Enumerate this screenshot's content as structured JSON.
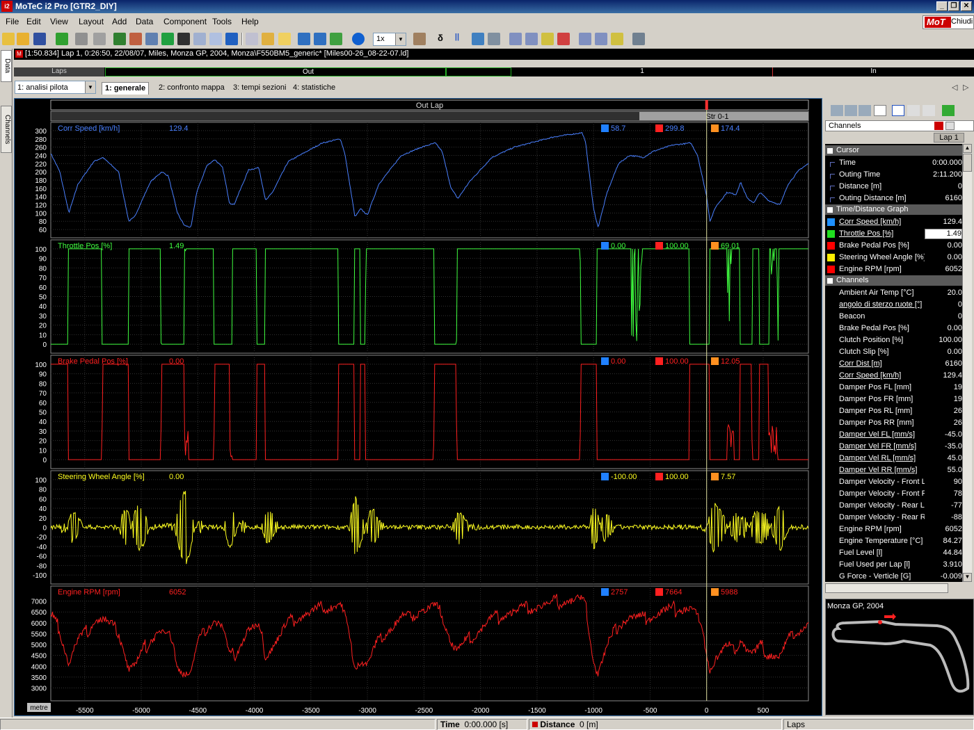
{
  "window": {
    "app_icon": "i2",
    "title": "MoTeC i2 Pro [GTR2_DIY]",
    "min": "_",
    "restore": "❐",
    "close": "✕"
  },
  "menu": [
    "File",
    "Edit",
    "View",
    "Layout",
    "Add",
    "Data",
    "Component",
    "Tools",
    "Help"
  ],
  "logo": {
    "brand": "MoT",
    "close_label": "Chiudi"
  },
  "toolbar": {
    "zoom_value": "1x",
    "delta_symbol": "δ",
    "pause_symbol": "||"
  },
  "left_tabs": {
    "data": "Data",
    "channels": "Channels"
  },
  "info": {
    "icon": "M",
    "text": "[1:50.834] Lap 1, 0:26:50, 22/08/07, Miles, Monza GP, 2004, Monza\\F550BM5_generic* [Miles00-26_08-22-07.ld]"
  },
  "laps_bar": {
    "label": "Laps",
    "out": "Out",
    "lap1": "1",
    "in": "In"
  },
  "worksheet": {
    "selected": "1: analisi pilota",
    "tabs": [
      "1: generale",
      "2: confronto mappa",
      "3: tempi sezioni",
      "4: statistiche"
    ],
    "nav_left": "◁",
    "nav_right": "▷"
  },
  "graph": {
    "lap_label": "Out Lap",
    "sector_label": "Str 0-1",
    "x_unit": "metre",
    "x_ticks": [
      "-5500",
      "-5000",
      "-4500",
      "-4000",
      "-3500",
      "-3000",
      "-2500",
      "-2000",
      "-1500",
      "-1000",
      "-500",
      "0",
      "500"
    ],
    "x_values": [
      -5500,
      -5000,
      -4500,
      -4000,
      -3500,
      -3000,
      -2500,
      -2000,
      -1500,
      -1000,
      -500,
      0,
      500
    ],
    "x_range": [
      -5800,
      900
    ],
    "cursor_x": 0,
    "panes": [
      {
        "name": "Corr Speed [km/h]",
        "value": "129.4",
        "min": "58.7",
        "max": "299.8",
        "avg": "174.4",
        "color": "#4a80ff",
        "ticks": [
          "300",
          "280",
          "260",
          "240",
          "220",
          "200",
          "180",
          "160",
          "140",
          "120",
          "100",
          "80",
          "60"
        ],
        "range": [
          50,
          310
        ],
        "style": "smooth"
      },
      {
        "name": "Throttle Pos [%]",
        "value": "1.49",
        "min": "0.00",
        "max": "100.00",
        "avg": "69.01",
        "color": "#40ff40",
        "ticks": [
          "100",
          "90",
          "80",
          "70",
          "60",
          "50",
          "40",
          "30",
          "20",
          "10",
          "0"
        ],
        "range": [
          -5,
          105
        ],
        "style": "throttle"
      },
      {
        "name": "Brake Pedal Pos [%]",
        "value": "0.00",
        "min": "0.00",
        "max": "100.00",
        "avg": "12.05",
        "color": "#ff2020",
        "ticks": [
          "100",
          "90",
          "80",
          "70",
          "60",
          "50",
          "40",
          "30",
          "20",
          "10",
          "0"
        ],
        "range": [
          -5,
          105
        ],
        "style": "brake"
      },
      {
        "name": "Steering Wheel Angle [%]",
        "value": "0.00",
        "min": "-100.00",
        "max": "100.00",
        "avg": "7.57",
        "color": "#ffff20",
        "ticks": [
          "100",
          "80",
          "60",
          "40",
          "20",
          "0",
          "-20",
          "-40",
          "-60",
          "-80",
          "-100"
        ],
        "range": [
          -110,
          110
        ],
        "style": "steer"
      },
      {
        "name": "Engine RPM [rpm]",
        "value": "6052",
        "min": "2757",
        "max": "7664",
        "avg": "5988",
        "color": "#ff2020",
        "ticks": [
          "7000",
          "6500",
          "6000",
          "5500",
          "5000",
          "4500",
          "4000",
          "3500",
          "3000"
        ],
        "range": [
          2600,
          7500
        ],
        "style": "rpm"
      }
    ]
  },
  "right_panel": {
    "header": "Channels",
    "lap_tab": "Lap 1",
    "groups": [
      {
        "title": "Cursor",
        "rows": [
          {
            "name": "Time",
            "value": "0:00.000",
            "color": "",
            "link": false
          },
          {
            "name": "Outing Time",
            "value": "2:11.200",
            "color": "",
            "link": false
          },
          {
            "name": "Distance [m]",
            "value": "0",
            "color": "",
            "link": false
          },
          {
            "name": "Outing Distance [m]",
            "value": "6160",
            "color": "",
            "link": false
          }
        ]
      },
      {
        "title": "Time/Distance Graph",
        "rows": [
          {
            "name": "Corr Speed [km/h]",
            "value": "129.4",
            "color": "#1e90ff",
            "link": true
          },
          {
            "name": "Throttle Pos [%]",
            "value": "1.49",
            "color": "#20e020",
            "link": true
          },
          {
            "name": "Brake Pedal Pos [%]",
            "value": "0.00",
            "color": "#ff0000",
            "link": false
          },
          {
            "name": "Steering Wheel Angle [%]",
            "value": "0.00",
            "color": "#ffee00",
            "link": false
          },
          {
            "name": "Engine RPM [rpm]",
            "value": "6052",
            "color": "#ff0000",
            "link": false
          }
        ]
      },
      {
        "title": "Channels",
        "rows": [
          {
            "name": "Ambient Air Temp [°C]",
            "value": "20.0",
            "color": "",
            "link": false
          },
          {
            "name": "angolo di sterzo ruote [°]",
            "value": "0",
            "color": "",
            "link": true
          },
          {
            "name": "Beacon",
            "value": "0",
            "color": "",
            "link": false
          },
          {
            "name": "Brake Pedal Pos [%]",
            "value": "0.00",
            "color": "",
            "link": false
          },
          {
            "name": "Clutch Position [%]",
            "value": "100.00",
            "color": "",
            "link": false
          },
          {
            "name": "Clutch Slip [%]",
            "value": "0.00",
            "color": "",
            "link": false
          },
          {
            "name": "Corr Dist [m]",
            "value": "6160",
            "color": "",
            "link": true
          },
          {
            "name": "Corr Speed [km/h]",
            "value": "129.4",
            "color": "",
            "link": true
          },
          {
            "name": "Damper Pos FL [mm]",
            "value": "19",
            "color": "",
            "link": false
          },
          {
            "name": "Damper Pos FR [mm]",
            "value": "19",
            "color": "",
            "link": false
          },
          {
            "name": "Damper Pos RL [mm]",
            "value": "26",
            "color": "",
            "link": false
          },
          {
            "name": "Damper Pos RR [mm]",
            "value": "26",
            "color": "",
            "link": false
          },
          {
            "name": "Damper Vel FL [mm/s]",
            "value": "-45.0",
            "color": "",
            "link": true
          },
          {
            "name": "Damper Vel FR [mm/s]",
            "value": "-35.0",
            "color": "",
            "link": true
          },
          {
            "name": "Damper Vel RL [mm/s]",
            "value": "45.0",
            "color": "",
            "link": true
          },
          {
            "name": "Damper Vel RR [mm/s]",
            "value": "55.0",
            "color": "",
            "link": true
          },
          {
            "name": "Damper Velocity - Front L ...",
            "value": "90",
            "color": "",
            "link": false
          },
          {
            "name": "Damper Velocity - Front R ...",
            "value": "78",
            "color": "",
            "link": false
          },
          {
            "name": "Damper Velocity - Rear L ...",
            "value": "-77",
            "color": "",
            "link": false
          },
          {
            "name": "Damper Velocity - Rear R ...",
            "value": "-88",
            "color": "",
            "link": false
          },
          {
            "name": "Engine RPM [rpm]",
            "value": "6052",
            "color": "",
            "link": false
          },
          {
            "name": "Engine Temperature [°C]",
            "value": "84.27",
            "color": "",
            "link": false
          },
          {
            "name": "Fuel Level [l]",
            "value": "44.84",
            "color": "",
            "link": false
          },
          {
            "name": "Fuel Used per Lap [l]",
            "value": "3.910",
            "color": "",
            "link": false
          },
          {
            "name": "G Force - Verticle [G]",
            "value": "-0.009",
            "color": "",
            "link": false
          }
        ]
      }
    ],
    "track_map_label": "Monza GP, 2004"
  },
  "status": {
    "time_label": "Time",
    "time_value": "0:00.000 [s]",
    "dist_label": "Distance",
    "dist_value": "0 [m]",
    "laps": "Laps"
  }
}
